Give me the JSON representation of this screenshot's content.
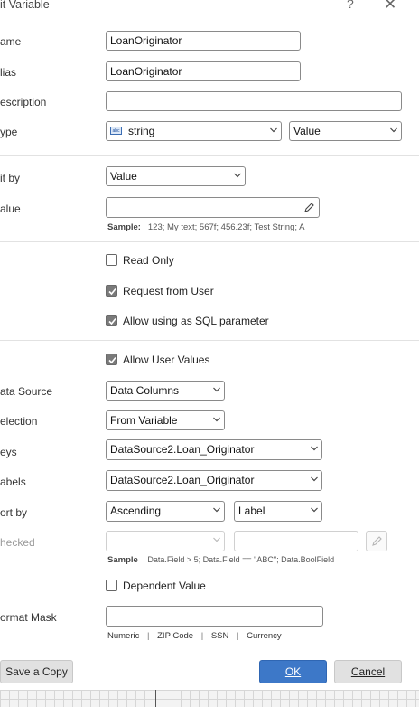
{
  "dialog": {
    "title": "it Variable",
    "help_glyph": "?",
    "close_glyph": "✕"
  },
  "fields": {
    "name_label": "ame",
    "name_value": "LoanOriginator",
    "alias_label": "lias",
    "alias_value": "LoanOriginator",
    "description_label": "escription",
    "description_value": "",
    "type_label": "ype",
    "type_value": "string",
    "type_icon": "string-type-icon",
    "type_kind_value": "Value"
  },
  "init": {
    "init_by_label": "it by",
    "init_by_value": "Value",
    "value_label": "alue",
    "value_value": "",
    "sample_label": "Sample:",
    "sample_text": "123; My text; 567f; 456.23f; Test String; A"
  },
  "options": {
    "read_only": {
      "label": "Read Only",
      "checked": false
    },
    "request_from_user": {
      "label": "Request from User",
      "checked": true
    },
    "allow_sql": {
      "label": "Allow using as SQL parameter",
      "checked": true
    }
  },
  "request": {
    "allow_user_values": {
      "label": "Allow User Values",
      "checked": true
    },
    "data_source_label": "ata Source",
    "data_source_value": "Data Columns",
    "selection_label": "election",
    "selection_value": "From Variable",
    "keys_label": "eys",
    "keys_value": "DataSource2.Loan_Originator",
    "labels_label": "abels",
    "labels_value": "DataSource2.Loan_Originator",
    "sort_by_label": "ort by",
    "sort_by_value": "Ascending",
    "sort_field_value": "Label",
    "checked_label": "hecked",
    "checked_value": "",
    "checked_expr_value": "",
    "checked_sample_label": "Sample",
    "checked_sample_text": "Data.Field > 5; Data.Field == \"ABC\"; Data.BoolField",
    "dependent_value": {
      "label": "Dependent Value",
      "checked": false
    },
    "format_mask_label": "ormat Mask",
    "format_mask_value": "",
    "mask_presets": [
      "Numeric",
      "ZIP Code",
      "SSN",
      "Currency"
    ],
    "mask_separator": "|"
  },
  "footer": {
    "save_copy_label": "Save a Copy",
    "ok_label": "OK",
    "cancel_label": "Cancel"
  },
  "colors": {
    "accent": "#3d78c8",
    "checkbox_checked": "#7a7a7a"
  }
}
